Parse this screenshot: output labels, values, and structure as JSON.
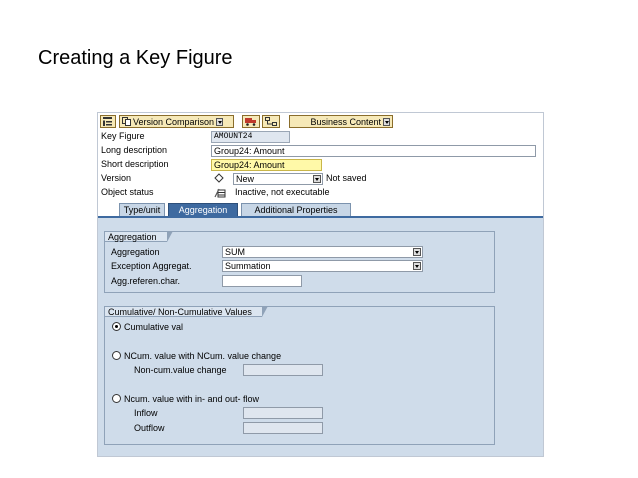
{
  "slide": {
    "title": "Creating a Key Figure"
  },
  "toolbar": {
    "version_comparison_label": "Version Comparison",
    "business_content_label": "Business Content"
  },
  "header": {
    "key_figure": {
      "label": "Key Figure",
      "value": "AMOUNT24"
    },
    "long_description": {
      "label": "Long description",
      "value": "Group24: Amount"
    },
    "short_description": {
      "label": "Short description",
      "value": "Group24: Amount"
    },
    "version": {
      "label": "Version",
      "value": "New",
      "status": "Not saved"
    },
    "object_status": {
      "label": "Object status",
      "value": "Inactive, not executable"
    }
  },
  "tabs": [
    {
      "label": "Type/unit",
      "active": false
    },
    {
      "label": "Aggregation",
      "active": true
    },
    {
      "label": "Additional Properties",
      "active": false
    }
  ],
  "aggregation_group": {
    "title": "Aggregation",
    "aggregation": {
      "label": "Aggregation",
      "value": "SUM"
    },
    "exception_aggregation": {
      "label": "Exception Aggregat.",
      "value": "Summation"
    },
    "agg_reference_char": {
      "label": "Agg.referen.char.",
      "value": ""
    }
  },
  "cumulative_group": {
    "title": "Cumulative/ Non-Cumulative Values",
    "options": [
      {
        "label": "Cumulative val",
        "selected": true
      },
      {
        "label": "NCum. value with NCum. value change",
        "selected": false
      },
      {
        "label": "Ncum. value with in- and out- flow",
        "selected": false
      }
    ],
    "noncum_value_change": {
      "label": "Non-cum.value change",
      "value": ""
    },
    "inflow": {
      "label": "Inflow",
      "value": ""
    },
    "outflow": {
      "label": "Outflow",
      "value": ""
    }
  },
  "colors": {
    "panel_bg": "#cfdcea",
    "tab_active": "#3e6aa0",
    "toolbar_button": "#f6e9b8",
    "highlight_field": "#fff9a8"
  }
}
